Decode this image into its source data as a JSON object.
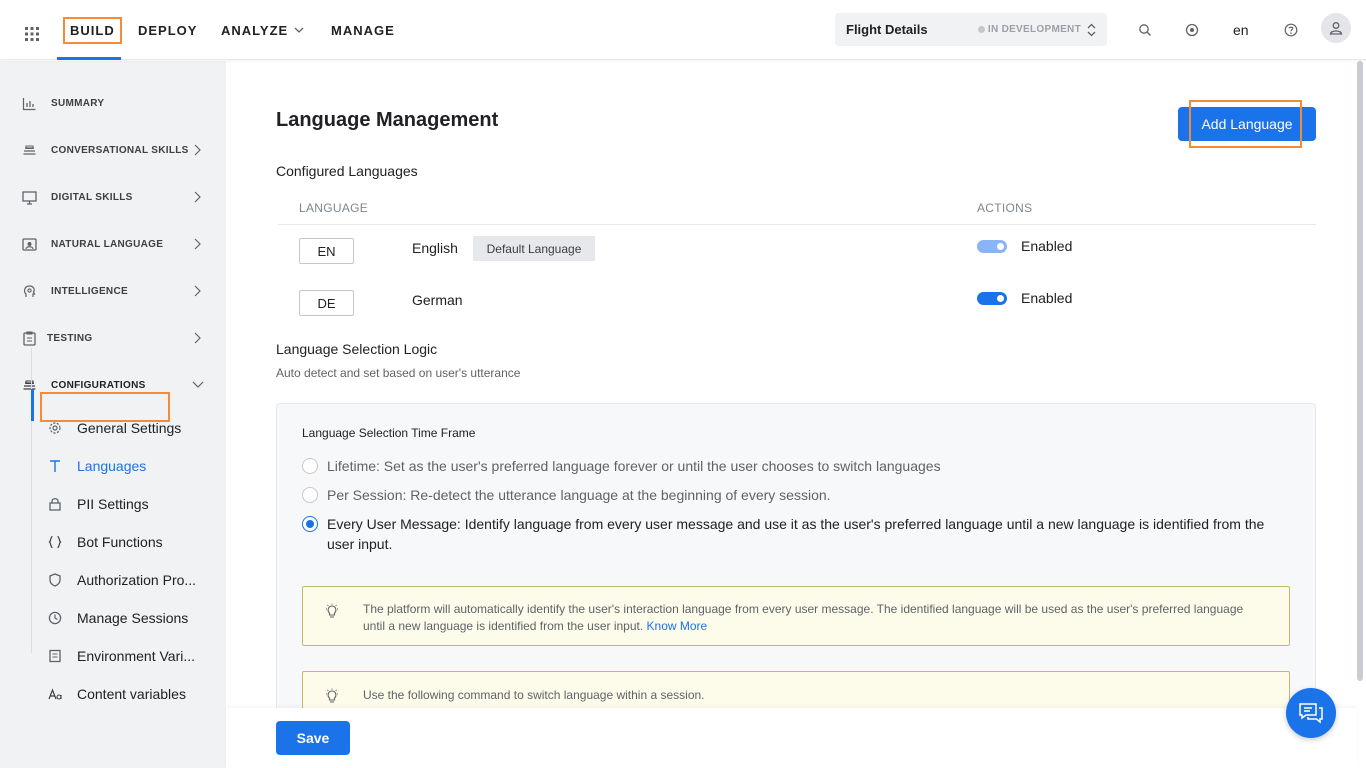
{
  "topbar": {
    "nav": {
      "build": "BUILD",
      "deploy": "DEPLOY",
      "analyze": "ANALYZE",
      "manage": "MANAGE"
    },
    "bot": {
      "name": "Flight Details",
      "status": "IN DEVELOPMENT"
    },
    "language_code": "en",
    "icons": [
      "apps-grid-icon",
      "search-icon",
      "target-icon",
      "help-icon",
      "user-icon"
    ]
  },
  "sidebar": {
    "items": [
      {
        "label": "SUMMARY",
        "icon": "bar-chart-icon"
      },
      {
        "label": "CONVERSATIONAL SKILLS",
        "icon": "layers-icon"
      },
      {
        "label": "DIGITAL SKILLS",
        "icon": "monitor-icon"
      },
      {
        "label": "NATURAL LANGUAGE",
        "icon": "nlp-icon"
      },
      {
        "label": "INTELLIGENCE",
        "icon": "brain-icon"
      },
      {
        "label": "TESTING",
        "icon": "clipboard-icon"
      },
      {
        "label": "CONFIGURATIONS",
        "icon": "layers-icon"
      }
    ],
    "configurations": [
      {
        "label": "General Settings",
        "icon": "gear-icon"
      },
      {
        "label": "Languages",
        "icon": "text-icon"
      },
      {
        "label": "PII Settings",
        "icon": "lock-icon"
      },
      {
        "label": "Bot Functions",
        "icon": "braces-icon"
      },
      {
        "label": "Authorization Pro...",
        "icon": "shield-icon"
      },
      {
        "label": "Manage Sessions",
        "icon": "clock-icon"
      },
      {
        "label": "Environment Vari...",
        "icon": "document-icon"
      },
      {
        "label": "Content variables",
        "icon": "font-icon"
      }
    ]
  },
  "main": {
    "title": "Language Management",
    "add_button": "Add Language",
    "configured_title": "Configured Languages",
    "columns": {
      "language": "LANGUAGE",
      "actions": "ACTIONS"
    },
    "languages": [
      {
        "code": "EN",
        "name": "English",
        "badge": "Default Language",
        "status": "Enabled",
        "toggle_color": "#8ab4f8"
      },
      {
        "code": "DE",
        "name": "German",
        "badge": "",
        "status": "Enabled",
        "toggle_color": "#1a73e8"
      }
    ],
    "selection_logic": {
      "title": "Language Selection Logic",
      "subtitle": "Auto detect and set based on user's utterance"
    },
    "time_frame": {
      "title": "Language Selection Time Frame",
      "options": [
        {
          "label": "Lifetime: Set as the user's preferred language forever or until the user chooses to switch languages",
          "checked": false
        },
        {
          "label": "Per Session: Re-detect the utterance language at the beginning of every session.",
          "checked": false
        },
        {
          "label": "Every User Message: Identify language from every user message and use it as the user's preferred language until a new language is identified from the user input.",
          "checked": true
        }
      ]
    },
    "notes": [
      {
        "text": "The platform will automatically identify the user's interaction language from every user message. The identified language will be used as the user's preferred language until a new language is identified from the user input.",
        "link": "Know More"
      },
      {
        "text": "Use the following command to switch language within a session.",
        "link": ""
      }
    ]
  },
  "footer": {
    "save": "Save"
  },
  "colors": {
    "accent": "#1a73e8",
    "highlight": "#f28c38",
    "sidebar_bg": "#f1f2f4"
  }
}
